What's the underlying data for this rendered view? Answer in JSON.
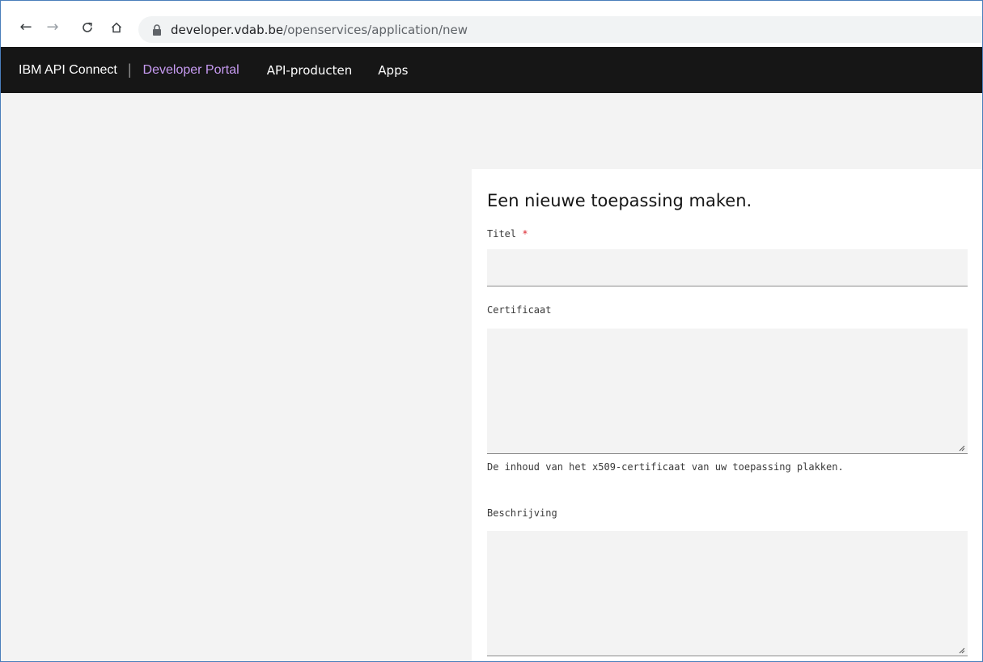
{
  "browser": {
    "url_host": "developer.vdab.be",
    "url_path": "/openservices/application/new",
    "back_icon": "arrow-left-icon",
    "forward_icon": "arrow-right-icon",
    "reload_icon": "reload-icon",
    "home_icon": "home-icon",
    "lock_icon": "lock-icon"
  },
  "topnav": {
    "brand": "IBM API Connect",
    "separator": "|",
    "links": [
      {
        "label": "Developer Portal"
      },
      {
        "label": "API-producten"
      },
      {
        "label": "Apps"
      }
    ],
    "colors": {
      "background": "#161616",
      "active": "#c79bf2"
    }
  },
  "form": {
    "heading": "Een nieuwe toepassing maken.",
    "title_label": "Titel",
    "required_marker": "*",
    "title_value": "",
    "certificate_label": "Certificaat",
    "certificate_value": "",
    "certificate_helper": "De inhoud van het x509-certificaat van uw toepassing plakken.",
    "description_label": "Beschrijving",
    "description_value": ""
  }
}
